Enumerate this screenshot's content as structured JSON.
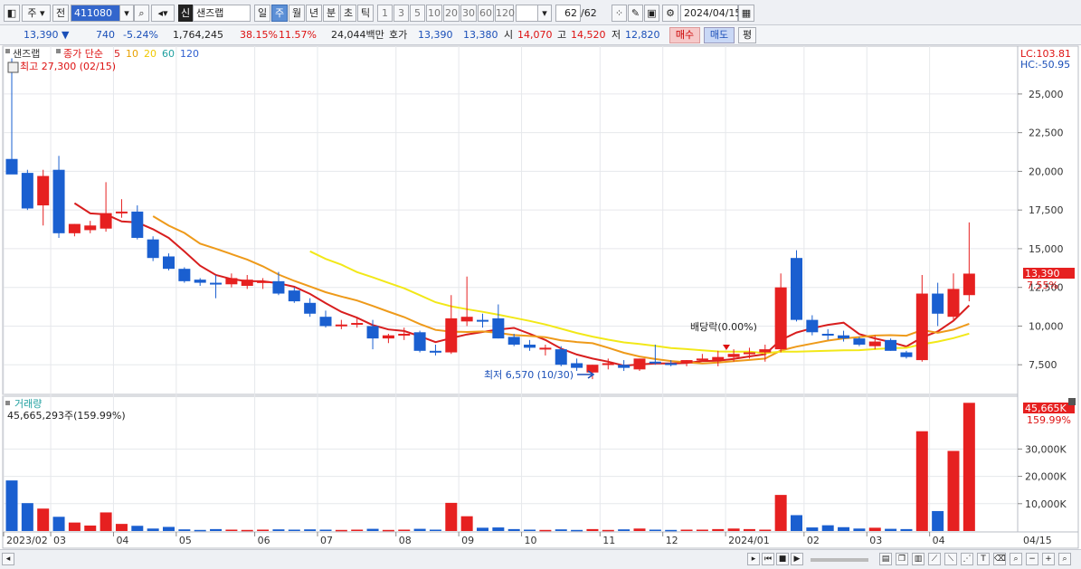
{
  "toolbar": {
    "period_tabs": [
      "일",
      "주",
      "월",
      "년",
      "분",
      "초",
      "틱"
    ],
    "interval_tabs": [
      "1",
      "3",
      "5",
      "10",
      "20",
      "30",
      "60",
      "120"
    ],
    "market_selector": "주",
    "prefix_label": "전",
    "code": "411080",
    "badge": "신",
    "name": "샌즈랩",
    "count": "62",
    "count_total": "/62",
    "date": "2024/04/15"
  },
  "quote": {
    "price": "13,390",
    "change": "740",
    "change_pct": "-5.24%",
    "volume": "1,764,245",
    "ratio1": "38.15%",
    "ratio2": "11.57%",
    "amount": "24,044백만",
    "hoga_label": "호가",
    "hoga1": "13,390",
    "hoga2": "13,380",
    "open_label": "시",
    "open": "14,070",
    "high_label": "고",
    "high": "14,520",
    "low_label": "저",
    "low": "12,820",
    "buy_label": "매수",
    "sell_label": "매도",
    "eval_label": "평"
  },
  "price_panel": {
    "name": "샌즈랩",
    "indicator_label": "종가 단순",
    "ma_periods": [
      "5",
      "10",
      "20",
      "60",
      "120"
    ],
    "ma_colors": [
      "#d81e1e",
      "#e8a000",
      "#f0c800",
      "#20a0a0",
      "#3060d0"
    ],
    "lc_label": "LC:103.81",
    "hc_label": "HC:-50.95",
    "max_note": "최고 27,300 (02/15)",
    "min_note": "최저 6,570 (10/30)",
    "dividend_note": "배당락(0.00%)",
    "last_price_tag": "13,390",
    "last_pct_tag": "7.55%"
  },
  "volume_panel": {
    "title": "거래량",
    "value_label": "45,665,293주(159.99%)",
    "last_tag": "45,665K",
    "last_pct": "159.99%"
  },
  "chart_data": {
    "type": "candlestick",
    "y_ticks": [
      "7,500",
      "10,000",
      "12,500",
      "15,000",
      "17,500",
      "20,000",
      "22,500",
      "25,000"
    ],
    "y_tick_values": [
      7500,
      10000,
      12500,
      15000,
      17500,
      20000,
      22500,
      25000
    ],
    "ylim": [
      5700,
      27800
    ],
    "x_labels": [
      "2023/02",
      "03",
      "04",
      "05",
      "06",
      "07",
      "08",
      "09",
      "10",
      "11",
      "12",
      "2024/01",
      "02",
      "03",
      "04",
      "04/15"
    ],
    "x_label_positions": [
      0,
      3,
      7,
      11,
      16,
      20,
      25,
      29,
      33,
      38,
      42,
      46,
      51,
      55,
      59
    ],
    "volume_ticks": [
      "10,000K",
      "20,000K",
      "30,000K"
    ],
    "volume_tick_values": [
      10000,
      20000,
      30000
    ],
    "volume_max": 47000,
    "candles": [
      {
        "o": 20800,
        "h": 27300,
        "l": 19900,
        "c": 19800,
        "v": 18500
      },
      {
        "o": 19900,
        "h": 20100,
        "l": 17500,
        "c": 17600,
        "v": 10200
      },
      {
        "o": 17800,
        "h": 20100,
        "l": 16500,
        "c": 19700,
        "v": 8200
      },
      {
        "o": 20100,
        "h": 21000,
        "l": 15700,
        "c": 16000,
        "v": 5200
      },
      {
        "o": 16000,
        "h": 16600,
        "l": 15800,
        "c": 16600,
        "v": 3100
      },
      {
        "o": 16200,
        "h": 16800,
        "l": 16000,
        "c": 16500,
        "v": 2000
      },
      {
        "o": 16300,
        "h": 19300,
        "l": 16100,
        "c": 17300,
        "v": 6800
      },
      {
        "o": 17400,
        "h": 18200,
        "l": 17000,
        "c": 17400,
        "v": 2600
      },
      {
        "o": 17400,
        "h": 17800,
        "l": 15600,
        "c": 15700,
        "v": 1900
      },
      {
        "o": 15600,
        "h": 15800,
        "l": 14200,
        "c": 14400,
        "v": 900
      },
      {
        "o": 14500,
        "h": 14700,
        "l": 13600,
        "c": 13700,
        "v": 1500
      },
      {
        "o": 13700,
        "h": 13800,
        "l": 12800,
        "c": 12900,
        "v": 600
      },
      {
        "o": 13000,
        "h": 13100,
        "l": 12600,
        "c": 12800,
        "v": 400
      },
      {
        "o": 12800,
        "h": 13300,
        "l": 11800,
        "c": 12700,
        "v": 700
      },
      {
        "o": 12700,
        "h": 13400,
        "l": 12500,
        "c": 13100,
        "v": 500
      },
      {
        "o": 12600,
        "h": 13300,
        "l": 12400,
        "c": 13000,
        "v": 400
      },
      {
        "o": 12800,
        "h": 13100,
        "l": 12400,
        "c": 12900,
        "v": 500
      },
      {
        "o": 12900,
        "h": 13500,
        "l": 12000,
        "c": 12100,
        "v": 600
      },
      {
        "o": 12300,
        "h": 12500,
        "l": 11500,
        "c": 11600,
        "v": 500
      },
      {
        "o": 11500,
        "h": 11800,
        "l": 10600,
        "c": 10800,
        "v": 600
      },
      {
        "o": 10600,
        "h": 11000,
        "l": 9900,
        "c": 10000,
        "v": 500
      },
      {
        "o": 10100,
        "h": 10400,
        "l": 9800,
        "c": 10100,
        "v": 400
      },
      {
        "o": 10200,
        "h": 10500,
        "l": 9900,
        "c": 10200,
        "v": 500
      },
      {
        "o": 10000,
        "h": 10400,
        "l": 8500,
        "c": 9200,
        "v": 800
      },
      {
        "o": 9200,
        "h": 9500,
        "l": 8900,
        "c": 9400,
        "v": 400
      },
      {
        "o": 9400,
        "h": 9900,
        "l": 9100,
        "c": 9500,
        "v": 500
      },
      {
        "o": 9600,
        "h": 9700,
        "l": 8300,
        "c": 8400,
        "v": 800
      },
      {
        "o": 8400,
        "h": 8800,
        "l": 8100,
        "c": 8300,
        "v": 500
      },
      {
        "o": 8300,
        "h": 12000,
        "l": 8200,
        "c": 10500,
        "v": 10300
      },
      {
        "o": 10300,
        "h": 13200,
        "l": 10000,
        "c": 10600,
        "v": 5400
      },
      {
        "o": 10400,
        "h": 10800,
        "l": 9900,
        "c": 10300,
        "v": 1200
      },
      {
        "o": 10500,
        "h": 11400,
        "l": 9200,
        "c": 9200,
        "v": 1300
      },
      {
        "o": 9300,
        "h": 9500,
        "l": 8700,
        "c": 8800,
        "v": 700
      },
      {
        "o": 8800,
        "h": 9100,
        "l": 8400,
        "c": 8600,
        "v": 500
      },
      {
        "o": 8500,
        "h": 8800,
        "l": 8100,
        "c": 8600,
        "v": 400
      },
      {
        "o": 8500,
        "h": 8700,
        "l": 7400,
        "c": 7500,
        "v": 600
      },
      {
        "o": 7600,
        "h": 7900,
        "l": 7100,
        "c": 7300,
        "v": 400
      },
      {
        "o": 7000,
        "h": 7500,
        "l": 6570,
        "c": 7500,
        "v": 700
      },
      {
        "o": 7500,
        "h": 7900,
        "l": 7200,
        "c": 7600,
        "v": 400
      },
      {
        "o": 7500,
        "h": 7800,
        "l": 7100,
        "c": 7300,
        "v": 600
      },
      {
        "o": 7200,
        "h": 7900,
        "l": 7100,
        "c": 7900,
        "v": 900
      },
      {
        "o": 7700,
        "h": 8800,
        "l": 7500,
        "c": 7600,
        "v": 500
      },
      {
        "o": 7600,
        "h": 7800,
        "l": 7400,
        "c": 7500,
        "v": 400
      },
      {
        "o": 7600,
        "h": 7800,
        "l": 7400,
        "c": 7800,
        "v": 500
      },
      {
        "o": 7800,
        "h": 8200,
        "l": 7700,
        "c": 7900,
        "v": 500
      },
      {
        "o": 7800,
        "h": 8400,
        "l": 7400,
        "c": 8000,
        "v": 700
      },
      {
        "o": 8000,
        "h": 8500,
        "l": 7700,
        "c": 8200,
        "v": 900
      },
      {
        "o": 8200,
        "h": 8600,
        "l": 7900,
        "c": 8300,
        "v": 700
      },
      {
        "o": 8300,
        "h": 8800,
        "l": 7700,
        "c": 8500,
        "v": 500
      },
      {
        "o": 8500,
        "h": 13400,
        "l": 8300,
        "c": 12500,
        "v": 13200
      },
      {
        "o": 14400,
        "h": 14900,
        "l": 10300,
        "c": 10400,
        "v": 5800
      },
      {
        "o": 10400,
        "h": 10700,
        "l": 9400,
        "c": 9600,
        "v": 1300
      },
      {
        "o": 9500,
        "h": 9800,
        "l": 9100,
        "c": 9400,
        "v": 2100
      },
      {
        "o": 9400,
        "h": 9700,
        "l": 9000,
        "c": 9200,
        "v": 1400
      },
      {
        "o": 9200,
        "h": 9300,
        "l": 8700,
        "c": 8800,
        "v": 900
      },
      {
        "o": 8700,
        "h": 9400,
        "l": 8500,
        "c": 9000,
        "v": 1200
      },
      {
        "o": 9100,
        "h": 9200,
        "l": 8400,
        "c": 8400,
        "v": 800
      },
      {
        "o": 8300,
        "h": 8400,
        "l": 7900,
        "c": 8000,
        "v": 700
      },
      {
        "o": 7800,
        "h": 13300,
        "l": 7700,
        "c": 12100,
        "v": 36500
      },
      {
        "o": 12100,
        "h": 12800,
        "l": 10000,
        "c": 10800,
        "v": 7300
      },
      {
        "o": 10600,
        "h": 13400,
        "l": 10300,
        "c": 12400,
        "v": 29300
      },
      {
        "o": 12000,
        "h": 16700,
        "l": 11600,
        "c": 13390,
        "v": 46900
      }
    ]
  }
}
